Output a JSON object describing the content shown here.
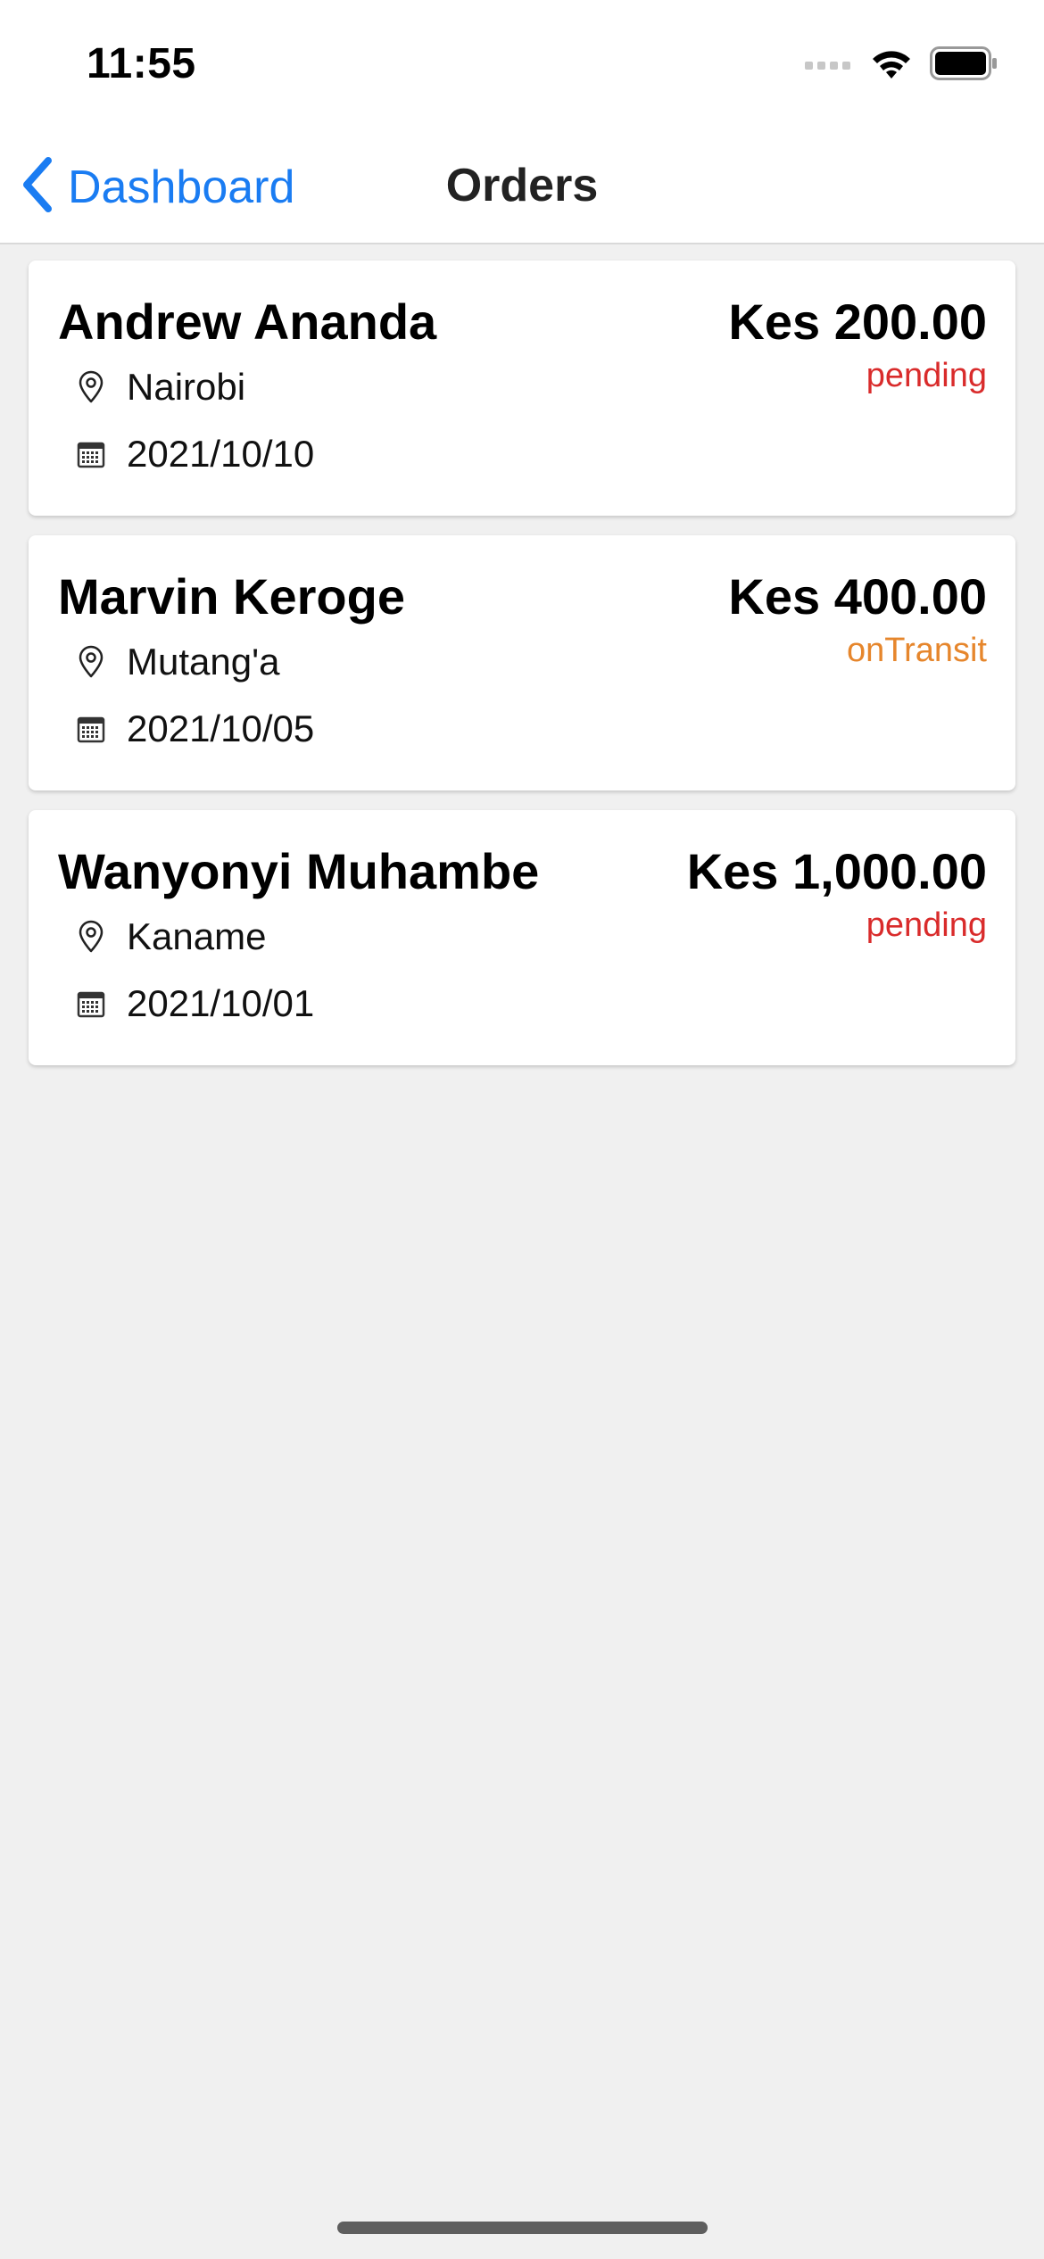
{
  "status_bar": {
    "time": "11:55"
  },
  "nav": {
    "back_label": "Dashboard",
    "title": "Orders"
  },
  "colors": {
    "accent": "#1a7cf2",
    "pending": "#d92b2b",
    "ontransit": "#e6862c"
  },
  "orders": [
    {
      "name": "Andrew Ananda",
      "amount": "Kes 200.00",
      "status": "pending",
      "location": "Nairobi",
      "date": "2021/10/10"
    },
    {
      "name": "Marvin Keroge",
      "amount": "Kes 400.00",
      "status": "onTransit",
      "location": "Mutang'a",
      "date": "2021/10/05"
    },
    {
      "name": "Wanyonyi Muhambe",
      "amount": "Kes 1,000.00",
      "status": "pending",
      "location": "Kaname",
      "date": "2021/10/01"
    }
  ]
}
